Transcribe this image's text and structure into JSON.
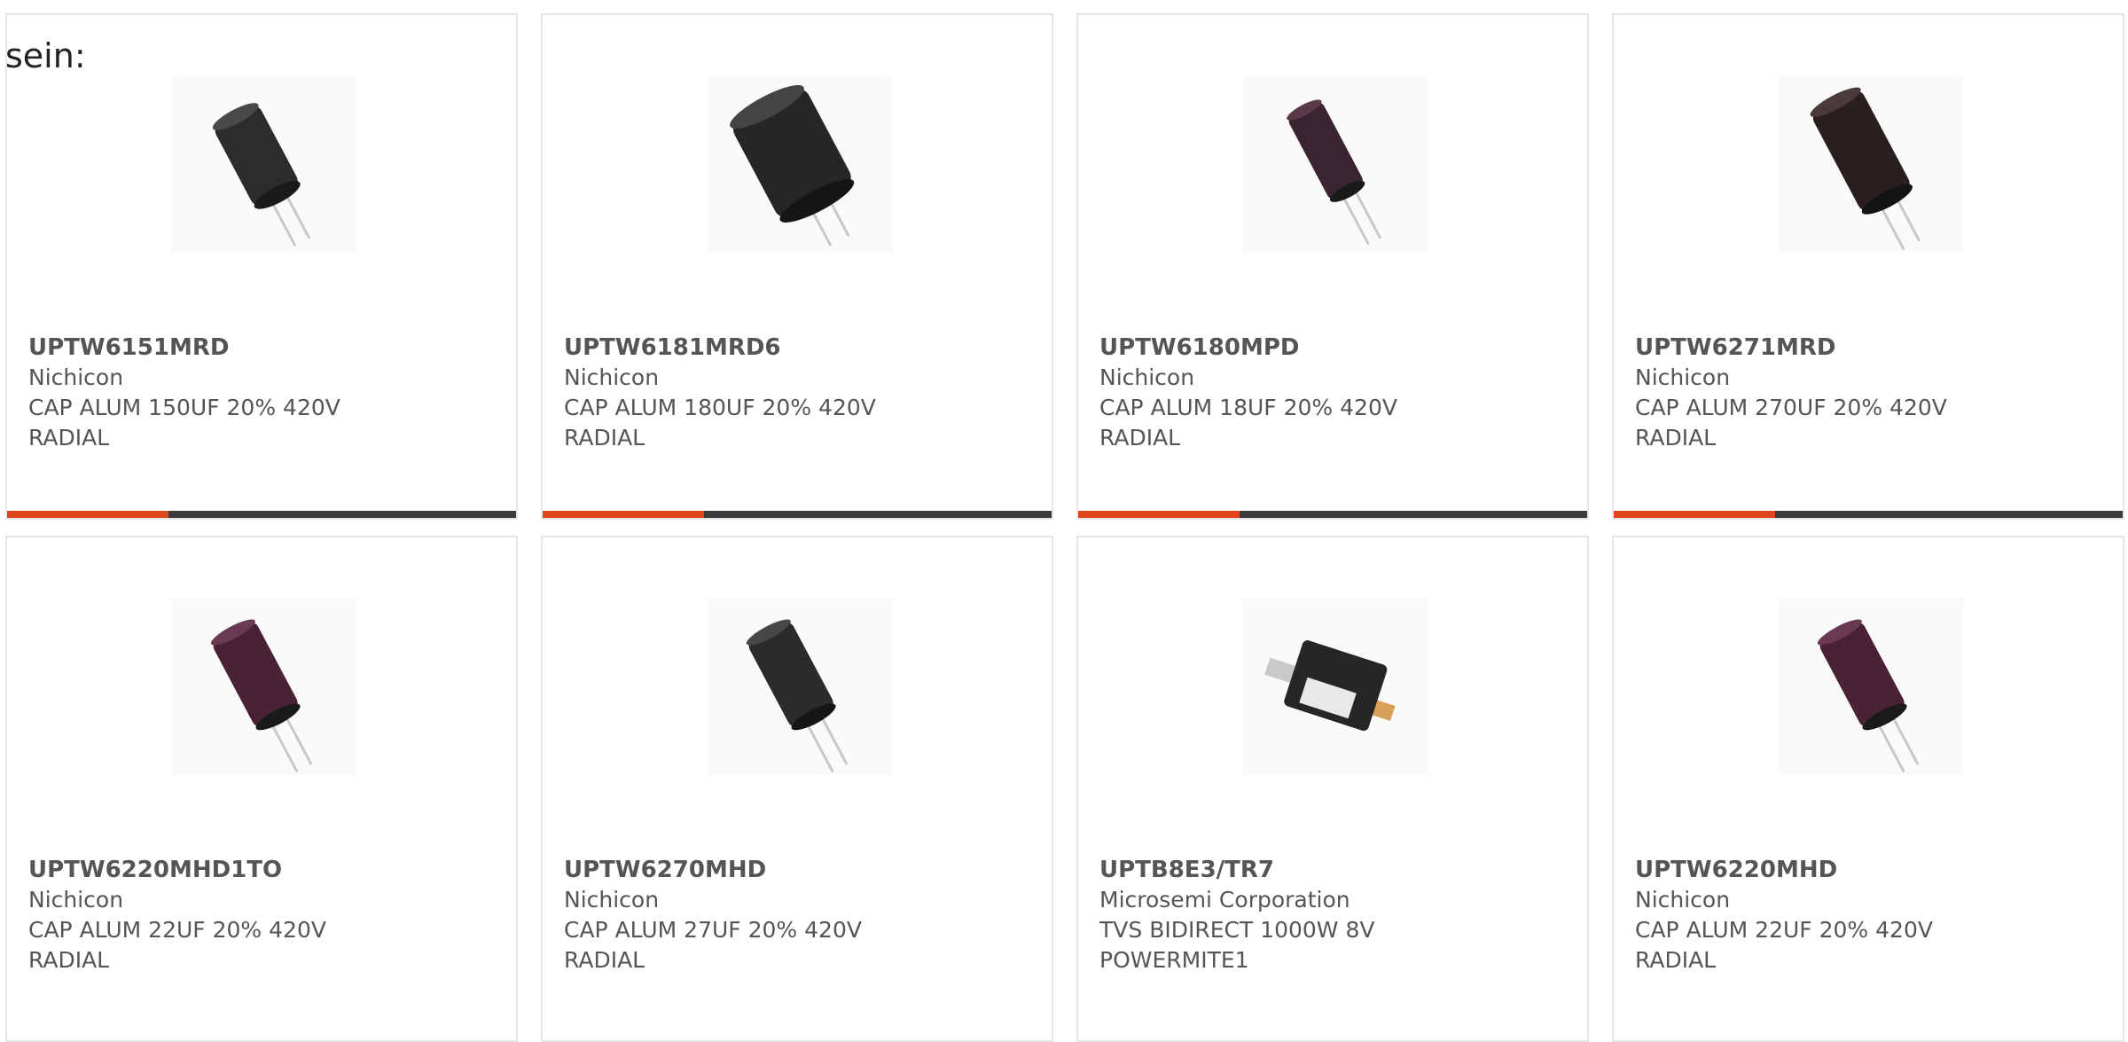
{
  "header_fragment": "sein:",
  "colors": {
    "accent": "#e2461d",
    "bar": "#3b3b3b",
    "border": "#e4e4e4",
    "text": "#555555"
  },
  "products": [
    {
      "part": "UPTW6151MRD",
      "manufacturer": "Nichicon",
      "description": "CAP ALUM 150UF 20% 420V RADIAL",
      "image_icon": "radial-capacitor-icon"
    },
    {
      "part": "UPTW6181MRD6",
      "manufacturer": "Nichicon",
      "description": "CAP ALUM 180UF 20% 420V RADIAL",
      "image_icon": "radial-capacitor-icon"
    },
    {
      "part": "UPTW6180MPD",
      "manufacturer": "Nichicon",
      "description": "CAP ALUM 18UF 20% 420V RADIAL",
      "image_icon": "radial-capacitor-icon"
    },
    {
      "part": "UPTW6271MRD",
      "manufacturer": "Nichicon",
      "description": "CAP ALUM 270UF 20% 420V RADIAL",
      "image_icon": "radial-capacitor-icon"
    },
    {
      "part": "UPTW6220MHD1TO",
      "manufacturer": "Nichicon",
      "description": "CAP ALUM 22UF 20% 420V RADIAL",
      "image_icon": "radial-capacitor-icon"
    },
    {
      "part": "UPTW6270MHD",
      "manufacturer": "Nichicon",
      "description": "CAP ALUM 27UF 20% 420V RADIAL",
      "image_icon": "radial-capacitor-icon"
    },
    {
      "part": "UPTB8E3/TR7",
      "manufacturer": "Microsemi Corporation",
      "description": "TVS BIDIRECT 1000W 8V POWERMITE1",
      "image_icon": "smd-diode-icon"
    },
    {
      "part": "UPTW6220MHD",
      "manufacturer": "Nichicon",
      "description": "CAP ALUM 22UF 20% 420V RADIAL",
      "image_icon": "radial-capacitor-icon"
    }
  ]
}
